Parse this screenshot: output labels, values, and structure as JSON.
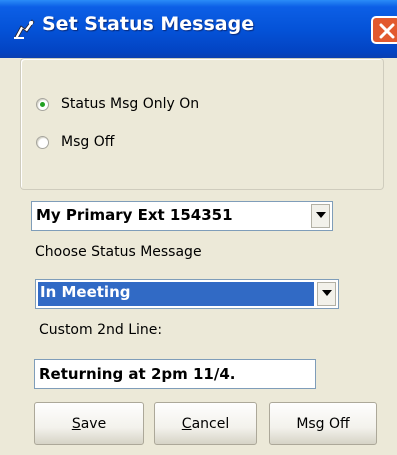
{
  "window": {
    "title": "Set Status Message"
  },
  "status_group": {
    "options": [
      {
        "label": "Status Msg Only On",
        "selected": true
      },
      {
        "label": "Msg Off",
        "selected": false
      }
    ]
  },
  "extension_select": {
    "value": "My Primary Ext 154351"
  },
  "choose_label": "Choose Status Message",
  "status_select": {
    "value": "In Meeting"
  },
  "custom_line": {
    "label": "Custom 2nd Line:",
    "value": "Returning at 2pm 11/4."
  },
  "buttons": {
    "save": {
      "mnemonic": "S",
      "rest": "ave"
    },
    "cancel": {
      "mnemonic": "C",
      "rest": "ancel"
    },
    "msg_off": "Msg Off"
  },
  "colors": {
    "title_bar": "#0451d6",
    "selection": "#316ac5",
    "dialog_bg": "#ece9d8",
    "radio_dot": "#21a121",
    "close": "#e2592e"
  },
  "icons": [
    "app-icon",
    "close-icon",
    "chevron-down-icon"
  ]
}
